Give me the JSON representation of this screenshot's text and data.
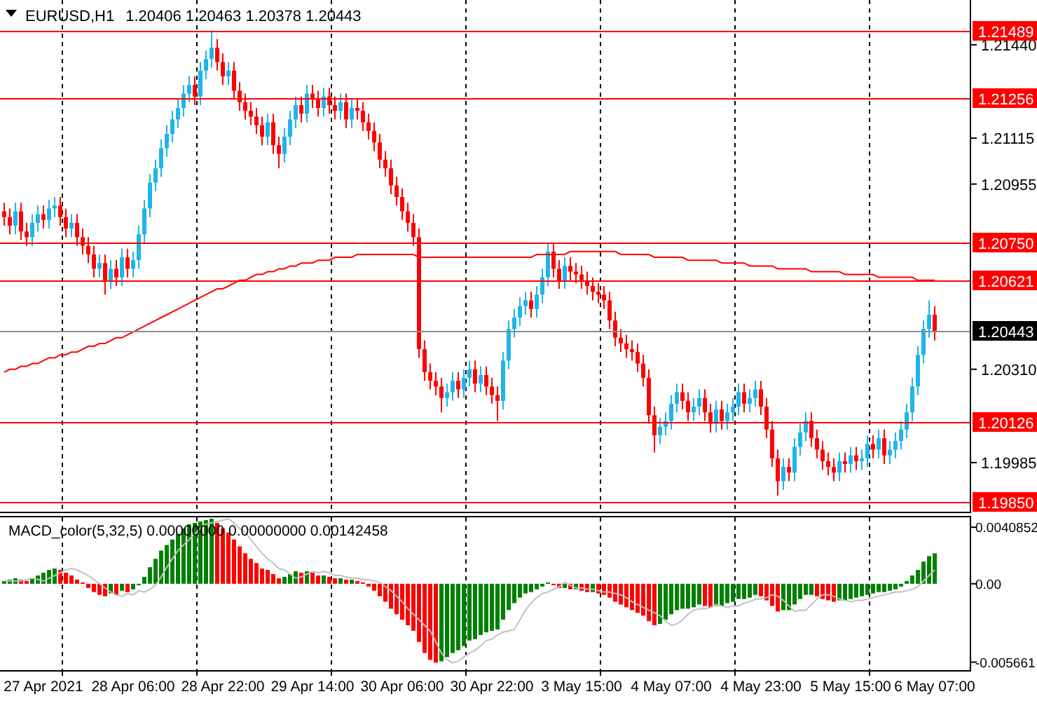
{
  "chart_header": {
    "symbol": "EURUSD,H1",
    "prices": [
      "1.20406",
      "1.20463",
      "1.20378",
      "1.20443"
    ]
  },
  "price_chart": {
    "chart_data": {
      "type": "candlestick",
      "ylim": [
        1.19809,
        1.21596
      ],
      "yticks": [
        {
          "value": 1.2144,
          "label": "1.21440"
        },
        {
          "value": 1.21115,
          "label": "1.21115"
        },
        {
          "value": 1.20955,
          "label": "1.20955"
        },
        {
          "value": 1.2031,
          "label": "1.20310"
        },
        {
          "value": 1.19985,
          "label": "1.19985"
        }
      ],
      "categories": [
        null,
        null,
        null,
        null,
        null,
        null,
        null,
        null,
        null,
        null,
        null,
        null,
        null,
        null,
        null,
        null,
        null,
        null,
        null,
        null,
        null,
        null,
        null,
        null,
        null,
        null,
        null,
        null,
        null,
        null,
        null,
        null,
        null,
        null,
        null,
        null,
        null,
        null,
        null,
        null,
        null,
        null,
        null,
        null,
        null,
        null,
        null,
        null,
        null,
        null,
        null,
        null,
        null,
        null,
        null,
        null,
        null,
        null,
        null,
        null,
        null,
        null,
        null,
        null,
        null,
        null,
        null,
        null,
        null,
        null,
        null,
        null,
        null,
        null,
        null,
        null,
        null,
        null,
        null,
        null,
        null,
        null,
        null,
        null,
        null,
        null,
        null,
        null,
        null,
        null,
        null,
        null,
        null,
        null,
        null,
        null,
        null,
        null,
        null,
        null,
        null,
        null,
        null,
        null,
        null,
        null,
        null,
        null,
        null,
        null,
        null,
        null,
        null,
        null,
        null,
        null,
        null,
        null,
        null,
        null,
        null,
        null,
        null,
        null,
        null,
        null,
        null,
        null,
        null,
        null,
        null,
        null,
        null,
        null,
        null,
        null,
        null,
        null,
        null,
        null,
        null,
        null,
        null,
        null,
        null,
        null,
        null,
        null,
        null,
        null,
        null,
        null,
        null,
        null,
        null,
        null,
        null,
        null,
        null,
        null,
        null,
        null,
        null,
        null,
        null,
        null,
        null
      ],
      "ohlc": [
        [
          1.2086,
          1.2089,
          1.2081,
          1.2084
        ],
        [
          1.2084,
          1.2087,
          1.2078,
          1.2081
        ],
        [
          1.2081,
          1.2089,
          1.2078,
          1.2086
        ],
        [
          1.2086,
          1.2089,
          1.2076,
          1.2079
        ],
        [
          1.2079,
          1.2082,
          1.2074,
          1.2077
        ],
        [
          1.2077,
          1.2085,
          1.2074,
          1.2082
        ],
        [
          1.2082,
          1.2088,
          1.2079,
          1.2085
        ],
        [
          1.2085,
          1.2088,
          1.208,
          1.2083
        ],
        [
          1.2083,
          1.209,
          1.208,
          1.2087
        ],
        [
          1.2087,
          1.2091,
          1.2084,
          1.2088
        ],
        [
          1.2088,
          1.2091,
          1.2081,
          1.2084
        ],
        [
          1.2084,
          1.2087,
          1.2077,
          1.208
        ],
        [
          1.208,
          1.2085,
          1.2077,
          1.2082
        ],
        [
          1.2082,
          1.2085,
          1.2074,
          1.2077
        ],
        [
          1.2077,
          1.208,
          1.2071,
          1.2074
        ],
        [
          1.2074,
          1.2077,
          1.2068,
          1.2071
        ],
        [
          1.2071,
          1.2074,
          1.2063,
          1.2066
        ],
        [
          1.2066,
          1.2071,
          1.2063,
          1.2068
        ],
        [
          1.2068,
          1.2071,
          1.2057,
          1.2062
        ],
        [
          1.2062,
          1.2069,
          1.2059,
          1.2066
        ],
        [
          1.2066,
          1.2069,
          1.206,
          1.2063
        ],
        [
          1.2063,
          1.2073,
          1.206,
          1.207
        ],
        [
          1.207,
          1.2073,
          1.2063,
          1.2066
        ],
        [
          1.2066,
          1.2072,
          1.2063,
          1.2069
        ],
        [
          1.2069,
          1.2081,
          1.2066,
          1.2078
        ],
        [
          1.2078,
          1.209,
          1.2075,
          1.2087
        ],
        [
          1.2087,
          1.2099,
          1.2084,
          1.2096
        ],
        [
          1.2096,
          1.2104,
          1.2093,
          1.2101
        ],
        [
          1.2101,
          1.2111,
          1.2098,
          1.2108
        ],
        [
          1.2108,
          1.2116,
          1.2105,
          1.2113
        ],
        [
          1.2113,
          1.2121,
          1.211,
          1.2118
        ],
        [
          1.2118,
          1.2125,
          1.2115,
          1.2122
        ],
        [
          1.2122,
          1.213,
          1.2119,
          1.2127
        ],
        [
          1.2127,
          1.2133,
          1.2124,
          1.213
        ],
        [
          1.213,
          1.2133,
          1.2123,
          1.2126
        ],
        [
          1.2126,
          1.2138,
          1.2123,
          1.2135
        ],
        [
          1.2135,
          1.2142,
          1.2132,
          1.2139
        ],
        [
          1.2139,
          1.2149,
          1.2136,
          1.2143
        ],
        [
          1.2143,
          1.2146,
          1.2135,
          1.2138
        ],
        [
          1.2138,
          1.2141,
          1.213,
          1.2133
        ],
        [
          1.2133,
          1.2138,
          1.213,
          1.2135
        ],
        [
          1.2135,
          1.2138,
          1.2125,
          1.2128
        ],
        [
          1.2128,
          1.2131,
          1.2121,
          1.2124
        ],
        [
          1.2124,
          1.2127,
          1.2118,
          1.2121
        ],
        [
          1.2121,
          1.2124,
          1.2116,
          1.2119
        ],
        [
          1.2119,
          1.2122,
          1.2113,
          1.2116
        ],
        [
          1.2116,
          1.2119,
          1.2109,
          1.2112
        ],
        [
          1.2112,
          1.212,
          1.2109,
          1.2117
        ],
        [
          1.2117,
          1.212,
          1.2106,
          1.2109
        ],
        [
          1.2109,
          1.2112,
          1.2101,
          1.2106
        ],
        [
          1.2106,
          1.2115,
          1.2103,
          1.2112
        ],
        [
          1.2112,
          1.2121,
          1.2109,
          1.2118
        ],
        [
          1.2118,
          1.2126,
          1.2115,
          1.2123
        ],
        [
          1.2123,
          1.2126,
          1.2117,
          1.212
        ],
        [
          1.212,
          1.213,
          1.2117,
          1.2127
        ],
        [
          1.2127,
          1.213,
          1.2122,
          1.2125
        ],
        [
          1.2125,
          1.2128,
          1.2119,
          1.2122
        ],
        [
          1.2122,
          1.2129,
          1.2119,
          1.2126
        ],
        [
          1.2126,
          1.2129,
          1.212,
          1.2123
        ],
        [
          1.2123,
          1.2126,
          1.2118,
          1.2121
        ],
        [
          1.2121,
          1.2127,
          1.2118,
          1.2124
        ],
        [
          1.2124,
          1.2127,
          1.2115,
          1.2118
        ],
        [
          1.2118,
          1.2125,
          1.2115,
          1.2122
        ],
        [
          1.2122,
          1.2125,
          1.2118,
          1.2121
        ],
        [
          1.2121,
          1.2124,
          1.2114,
          1.2117
        ],
        [
          1.2117,
          1.212,
          1.2111,
          1.2114
        ],
        [
          1.2114,
          1.2117,
          1.2107,
          1.211
        ],
        [
          1.211,
          1.2113,
          1.2101,
          1.2104
        ],
        [
          1.2104,
          1.2107,
          1.2098,
          1.2101
        ],
        [
          1.2101,
          1.2104,
          1.2092,
          1.2095
        ],
        [
          1.2095,
          1.2098,
          1.2088,
          1.2091
        ],
        [
          1.2091,
          1.2094,
          1.2083,
          1.2086
        ],
        [
          1.2086,
          1.2089,
          1.2079,
          1.2082
        ],
        [
          1.2082,
          1.2085,
          1.2074,
          1.2077
        ],
        [
          1.2077,
          1.208,
          1.2035,
          1.2038
        ],
        [
          1.2038,
          1.2041,
          1.2027,
          1.203
        ],
        [
          1.203,
          1.2033,
          1.2024,
          1.2027
        ],
        [
          1.2027,
          1.203,
          1.2022,
          1.2025
        ],
        [
          1.2025,
          1.2028,
          1.2016,
          1.2021
        ],
        [
          1.2021,
          1.2026,
          1.2018,
          1.2023
        ],
        [
          1.2023,
          1.203,
          1.202,
          1.2027
        ],
        [
          1.2027,
          1.203,
          1.2021,
          1.2024
        ],
        [
          1.2024,
          1.2031,
          1.2021,
          1.2028
        ],
        [
          1.2028,
          1.2034,
          1.2025,
          1.2031
        ],
        [
          1.2031,
          1.2034,
          1.2023,
          1.2026
        ],
        [
          1.2026,
          1.2032,
          1.2023,
          1.2029
        ],
        [
          1.2029,
          1.2032,
          1.2022,
          1.2025
        ],
        [
          1.2025,
          1.2028,
          1.2019,
          1.2022
        ],
        [
          1.2022,
          1.2025,
          1.2013,
          1.202
        ],
        [
          1.202,
          1.2037,
          1.2017,
          1.2034
        ],
        [
          1.2034,
          1.2048,
          1.2031,
          1.2045
        ],
        [
          1.2045,
          1.2052,
          1.2042,
          1.2049
        ],
        [
          1.2049,
          1.2056,
          1.2046,
          1.2053
        ],
        [
          1.2053,
          1.2058,
          1.205,
          1.2055
        ],
        [
          1.2055,
          1.2058,
          1.2049,
          1.2052
        ],
        [
          1.2052,
          1.206,
          1.2049,
          1.2057
        ],
        [
          1.2057,
          1.2066,
          1.2054,
          1.2063
        ],
        [
          1.2063,
          1.2075,
          1.206,
          1.2072
        ],
        [
          1.2072,
          1.2075,
          1.2063,
          1.2066
        ],
        [
          1.2066,
          1.2069,
          1.2059,
          1.2062
        ],
        [
          1.2062,
          1.207,
          1.2059,
          1.2067
        ],
        [
          1.2067,
          1.207,
          1.2062,
          1.2065
        ],
        [
          1.2065,
          1.2068,
          1.2061,
          1.2064
        ],
        [
          1.2064,
          1.2067,
          1.2059,
          1.2062
        ],
        [
          1.2062,
          1.2065,
          1.2057,
          1.206
        ],
        [
          1.206,
          1.2063,
          1.2055,
          1.2058
        ],
        [
          1.2058,
          1.2061,
          1.2054,
          1.2057
        ],
        [
          1.2057,
          1.206,
          1.2052,
          1.2055
        ],
        [
          1.2055,
          1.2058,
          1.2045,
          1.2048
        ],
        [
          1.2048,
          1.2051,
          1.2039,
          1.2042
        ],
        [
          1.2042,
          1.2045,
          1.2037,
          1.204
        ],
        [
          1.204,
          1.2043,
          1.2035,
          1.2038
        ],
        [
          1.2038,
          1.2041,
          1.2034,
          1.2037
        ],
        [
          1.2037,
          1.204,
          1.203,
          1.2033
        ],
        [
          1.2033,
          1.2036,
          1.2025,
          1.2028
        ],
        [
          1.2028,
          1.2031,
          1.2012,
          1.2015
        ],
        [
          1.2015,
          1.2018,
          1.2002,
          1.2008
        ],
        [
          1.2008,
          1.2014,
          1.2005,
          1.2011
        ],
        [
          1.2011,
          1.2016,
          1.2008,
          1.2013
        ],
        [
          1.2013,
          1.2022,
          1.201,
          1.2019
        ],
        [
          1.2019,
          1.2026,
          1.2016,
          1.2023
        ],
        [
          1.2023,
          1.2026,
          1.2017,
          1.202
        ],
        [
          1.202,
          1.2023,
          1.2013,
          1.2016
        ],
        [
          1.2016,
          1.2021,
          1.2013,
          1.2018
        ],
        [
          1.2018,
          1.2024,
          1.2015,
          1.2021
        ],
        [
          1.2021,
          1.2024,
          1.2013,
          1.2016
        ],
        [
          1.2016,
          1.2019,
          1.2009,
          1.2012
        ],
        [
          1.2012,
          1.202,
          1.2009,
          1.2017
        ],
        [
          1.2017,
          1.202,
          1.201,
          1.2013
        ],
        [
          1.2013,
          1.2019,
          1.201,
          1.2016
        ],
        [
          1.2016,
          1.2021,
          1.2013,
          1.2018
        ],
        [
          1.2018,
          1.2026,
          1.2015,
          1.2023
        ],
        [
          1.2023,
          1.2026,
          1.2016,
          1.2019
        ],
        [
          1.2019,
          1.2024,
          1.2016,
          1.2021
        ],
        [
          1.2021,
          1.2027,
          1.2018,
          1.2024
        ],
        [
          1.2024,
          1.2027,
          1.2015,
          1.2018
        ],
        [
          1.2018,
          1.2021,
          1.2007,
          1.201
        ],
        [
          1.201,
          1.2013,
          1.1997,
          1.2
        ],
        [
          1.2,
          1.2003,
          1.1987,
          1.1992
        ],
        [
          1.1992,
          1.2,
          1.1989,
          1.1997
        ],
        [
          1.1997,
          1.2,
          1.1992,
          1.1995
        ],
        [
          1.1995,
          1.2007,
          1.1992,
          1.2004
        ],
        [
          1.2004,
          1.2012,
          1.2001,
          1.2009
        ],
        [
          1.2009,
          1.2016,
          1.2006,
          1.2013
        ],
        [
          1.2013,
          1.2016,
          1.2004,
          1.2007
        ],
        [
          1.2007,
          1.201,
          1.2,
          1.2003
        ],
        [
          1.2003,
          1.2006,
          1.1996,
          1.1999
        ],
        [
          1.1999,
          1.2002,
          1.1994,
          1.1997
        ],
        [
          1.1997,
          1.2,
          1.1992,
          1.1995
        ],
        [
          1.1995,
          1.2002,
          1.1992,
          1.1999
        ],
        [
          1.1999,
          1.2002,
          1.1995,
          1.1998
        ],
        [
          1.1998,
          1.2004,
          1.1995,
          1.2001
        ],
        [
          1.2001,
          1.2004,
          1.1996,
          1.1999
        ],
        [
          1.1999,
          1.2003,
          1.1996,
          1.2
        ],
        [
          1.2,
          1.2008,
          1.1997,
          1.2005
        ],
        [
          1.2005,
          1.2008,
          1.2,
          1.2003
        ],
        [
          1.2003,
          1.201,
          1.2,
          1.2007
        ],
        [
          1.2007,
          1.201,
          1.1998,
          1.2001
        ],
        [
          1.2001,
          1.2006,
          1.1998,
          1.2003
        ],
        [
          1.2003,
          1.2009,
          1.2,
          1.2006
        ],
        [
          1.2006,
          1.2013,
          1.2003,
          1.201
        ],
        [
          1.201,
          1.2019,
          1.2007,
          1.2016
        ],
        [
          1.2016,
          1.2028,
          1.2013,
          1.2025
        ],
        [
          1.2025,
          1.2039,
          1.2022,
          1.2036
        ],
        [
          1.2036,
          1.2048,
          1.2033,
          1.2045
        ],
        [
          1.2045,
          1.2055,
          1.2042,
          1.205
        ],
        [
          1.205,
          1.2053,
          1.2041,
          1.2044
        ]
      ],
      "series": [
        {
          "type": "line",
          "color": "#ff0000",
          "values": [
            1.203,
            1.2031,
            1.2031,
            1.2032,
            1.2032,
            1.2033,
            1.2033,
            1.2034,
            1.2035,
            1.2035,
            1.2036,
            1.2036,
            1.2037,
            1.2037,
            1.2038,
            1.2039,
            1.2039,
            1.204,
            1.204,
            1.2041,
            1.2042,
            1.2042,
            1.2043,
            1.2044,
            1.2045,
            1.2046,
            1.2047,
            1.2048,
            1.2049,
            1.205,
            1.2051,
            1.2052,
            1.2053,
            1.2054,
            1.2055,
            1.2056,
            1.2057,
            1.2058,
            1.2059,
            1.2059,
            1.206,
            1.2061,
            1.2062,
            1.2062,
            1.2063,
            1.2064,
            1.2064,
            1.2065,
            1.2065,
            1.2066,
            1.2066,
            1.2067,
            1.2067,
            1.2068,
            1.2068,
            1.2068,
            1.2069,
            1.2069,
            1.2069,
            1.207,
            1.207,
            1.207,
            1.207,
            1.2071,
            1.2071,
            1.2071,
            1.2071,
            1.2071,
            1.2071,
            1.2071,
            1.2071,
            1.2071,
            1.2071,
            1.2071,
            1.207,
            1.207,
            1.207,
            1.207,
            1.207,
            1.207,
            1.207,
            1.207,
            1.207,
            1.207,
            1.207,
            1.207,
            1.207,
            1.207,
            1.207,
            1.207,
            1.207,
            1.207,
            1.207,
            1.207,
            1.207,
            1.2071,
            1.2071,
            1.2071,
            1.2071,
            1.2071,
            1.2071,
            1.2072,
            1.2072,
            1.2072,
            1.2072,
            1.2072,
            1.2072,
            1.2072,
            1.2072,
            1.2072,
            1.2071,
            1.2071,
            1.2071,
            1.2071,
            1.2071,
            1.2071,
            1.207,
            1.207,
            1.207,
            1.207,
            1.207,
            1.207,
            1.2069,
            1.2069,
            1.2069,
            1.2069,
            1.2069,
            1.2069,
            1.2068,
            1.2068,
            1.2068,
            1.2068,
            1.2068,
            1.2067,
            1.2067,
            1.2067,
            1.2067,
            1.2067,
            1.2066,
            1.2066,
            1.2066,
            1.2066,
            1.2066,
            1.2066,
            1.2065,
            1.2065,
            1.2065,
            1.2065,
            1.2065,
            1.2065,
            1.2064,
            1.2064,
            1.2064,
            1.2064,
            1.2064,
            1.2064,
            1.2063,
            1.2063,
            1.2063,
            1.2063,
            1.2063,
            1.2063,
            1.2063,
            1.2062,
            1.2062,
            1.2062,
            1.2062
          ]
        }
      ],
      "ref_lines": [
        {
          "axis": "y",
          "value": 1.21489,
          "label": "1.21489",
          "color": "#ff0000"
        },
        {
          "axis": "y",
          "value": 1.21256,
          "label": "1.21256",
          "color": "#ff0000"
        },
        {
          "axis": "y",
          "value": 1.2075,
          "label": "1.20750",
          "color": "#ff0000"
        },
        {
          "axis": "y",
          "value": 1.20621,
          "label": "1.20621",
          "color": "#ff0000"
        },
        {
          "axis": "y",
          "value": 1.20443,
          "label": "1.20443",
          "color": "#8c8c8c"
        },
        {
          "axis": "y",
          "value": 1.20126,
          "label": "1.20126",
          "color": "#ff0000"
        },
        {
          "axis": "y",
          "value": 1.1985,
          "label": "1.19850",
          "color": "#ff0000"
        }
      ]
    }
  },
  "indicator": {
    "label": "MACD_color(5,32,5) 0.00000000 0.00000000 0.00142458",
    "chart_data": {
      "type": "bar",
      "ylim": [
        -0.00624,
        0.0048
      ],
      "yticks": [
        {
          "value": 0.0040852,
          "label": "0.0040852"
        },
        {
          "value": 0,
          "label": "0.00"
        },
        {
          "value": -0.005661,
          "label": "-0.005661"
        }
      ],
      "categories": [
        null,
        null,
        null,
        null,
        null,
        null,
        null,
        "27 Apr 2021",
        null,
        null,
        null,
        null,
        null,
        null,
        null,
        null,
        null,
        null,
        null,
        null,
        null,
        null,
        null,
        "28 Apr 06:00",
        null,
        null,
        null,
        null,
        null,
        null,
        null,
        null,
        null,
        null,
        null,
        null,
        null,
        null,
        null,
        "28 Apr 22:00",
        null,
        null,
        null,
        null,
        null,
        null,
        null,
        null,
        null,
        null,
        null,
        null,
        null,
        null,
        null,
        "29 Apr 14:00",
        null,
        null,
        null,
        null,
        null,
        null,
        null,
        null,
        null,
        null,
        null,
        null,
        null,
        null,
        null,
        "30 Apr 06:00",
        null,
        null,
        null,
        null,
        null,
        null,
        null,
        null,
        null,
        null,
        null,
        null,
        null,
        null,
        null,
        "30 Apr 22:00",
        null,
        null,
        null,
        null,
        null,
        null,
        null,
        null,
        null,
        null,
        null,
        null,
        null,
        null,
        null,
        "3 May 15:00",
        null,
        null,
        null,
        null,
        null,
        null,
        null,
        null,
        null,
        null,
        null,
        null,
        null,
        null,
        null,
        "4 May 07:00",
        null,
        null,
        null,
        null,
        null,
        null,
        null,
        null,
        null,
        null,
        null,
        null,
        null,
        null,
        null,
        "4 May 23:00",
        null,
        null,
        null,
        null,
        null,
        null,
        null,
        null,
        null,
        null,
        null,
        null,
        null,
        null,
        null,
        "5 May 15:00",
        null,
        null,
        null,
        null,
        null,
        null,
        null,
        null,
        null,
        null,
        null,
        null,
        null,
        null,
        "6 May 07:00"
      ],
      "series": [
        {
          "type": "bar",
          "colors": [
            "#008000",
            "#008000",
            "#008000",
            "#ff0000",
            "#ff0000",
            "#008000",
            "#008000",
            "#008000",
            "#008000",
            "#008000",
            "#ff0000",
            "#ff0000",
            "#ff0000",
            "#ff0000",
            "#ff0000",
            "#ff0000",
            "#ff0000",
            "#ff0000",
            "#ff0000",
            "#008000",
            "#ff0000",
            "#008000",
            "#ff0000",
            "#008000",
            "#008000",
            "#008000",
            "#008000",
            "#008000",
            "#008000",
            "#008000",
            "#008000",
            "#008000",
            "#008000",
            "#008000",
            "#008000",
            "#008000",
            "#008000",
            "#008000",
            "#ff0000",
            "#ff0000",
            "#ff0000",
            "#ff0000",
            "#ff0000",
            "#ff0000",
            "#ff0000",
            "#ff0000",
            "#ff0000",
            "#ff0000",
            "#ff0000",
            "#ff0000",
            "#008000",
            "#008000",
            "#008000",
            "#ff0000",
            "#008000",
            "#ff0000",
            "#ff0000",
            "#008000",
            "#ff0000",
            "#ff0000",
            "#008000",
            "#ff0000",
            "#008000",
            "#ff0000",
            "#ff0000",
            "#ff0000",
            "#ff0000",
            "#ff0000",
            "#ff0000",
            "#ff0000",
            "#ff0000",
            "#ff0000",
            "#ff0000",
            "#ff0000",
            "#ff0000",
            "#ff0000",
            "#ff0000",
            "#ff0000",
            "#008000",
            "#008000",
            "#008000",
            "#008000",
            "#008000",
            "#008000",
            "#008000",
            "#008000",
            "#008000",
            "#008000",
            "#008000",
            "#008000",
            "#008000",
            "#008000",
            "#008000",
            "#008000",
            "#008000",
            "#008000",
            "#008000",
            "#008000",
            "#ff0000",
            "#ff0000",
            "#008000",
            "#ff0000",
            "#008000",
            "#ff0000",
            "#ff0000",
            "#008000",
            "#ff0000",
            "#ff0000",
            "#ff0000",
            "#ff0000",
            "#ff0000",
            "#ff0000",
            "#ff0000",
            "#ff0000",
            "#ff0000",
            "#ff0000",
            "#ff0000",
            "#008000",
            "#008000",
            "#008000",
            "#008000",
            "#008000",
            "#008000",
            "#008000",
            "#008000",
            "#ff0000",
            "#ff0000",
            "#008000",
            "#008000",
            "#008000",
            "#008000",
            "#008000",
            "#008000",
            "#008000",
            "#008000",
            "#ff0000",
            "#ff0000",
            "#ff0000",
            "#ff0000",
            "#008000",
            "#008000",
            "#008000",
            "#008000",
            "#008000",
            "#008000",
            "#ff0000",
            "#ff0000",
            "#ff0000",
            "#ff0000",
            "#008000",
            "#008000",
            "#008000",
            "#008000",
            "#008000",
            "#008000",
            "#008000",
            "#008000",
            "#008000",
            "#008000",
            "#008000",
            "#008000",
            "#008000",
            "#008000",
            "#008000",
            "#008000",
            "#008000",
            "#008000"
          ],
          "values": [
            0.0002,
            0.0003,
            0.0004,
            0.0003,
            0.0002,
            0.0004,
            0.0006,
            0.0008,
            0.001,
            0.0011,
            0.001,
            0.0008,
            0.0006,
            0.0003,
            0.0001,
            -0.0003,
            -0.0006,
            -0.0008,
            -0.0009,
            -0.0007,
            -0.0008,
            -0.0005,
            -0.0006,
            -0.0004,
            -0.0001,
            0.0005,
            0.0012,
            0.0018,
            0.0024,
            0.0028,
            0.0032,
            0.0036,
            0.004,
            0.0043,
            0.0044,
            0.0045,
            0.0046,
            0.0047,
            0.0044,
            0.004,
            0.0037,
            0.0032,
            0.0027,
            0.0022,
            0.0018,
            0.0015,
            0.0011,
            0.001,
            0.0007,
            0.0004,
            0.0005,
            0.0007,
            0.0009,
            0.0008,
            0.0009,
            0.0008,
            0.0006,
            0.0006,
            0.0005,
            0.0004,
            0.0004,
            0.0003,
            0.0003,
            0.0002,
            0.0001,
            -0.0002,
            -0.0005,
            -0.0009,
            -0.0013,
            -0.0018,
            -0.0022,
            -0.0026,
            -0.003,
            -0.0034,
            -0.0042,
            -0.005,
            -0.0055,
            -0.0057,
            -0.0056,
            -0.0053,
            -0.005,
            -0.0048,
            -0.0045,
            -0.0041,
            -0.004,
            -0.0037,
            -0.0035,
            -0.0034,
            -0.0033,
            -0.0026,
            -0.0019,
            -0.0014,
            -0.001,
            -0.0007,
            -0.0006,
            -0.0004,
            -0.0002,
            0.0001,
            -0.0001,
            -0.0003,
            -0.0003,
            -0.0004,
            -0.0004,
            -0.0005,
            -0.0006,
            -0.0006,
            -0.0007,
            -0.0008,
            -0.001,
            -0.0013,
            -0.0015,
            -0.0017,
            -0.0019,
            -0.0021,
            -0.0023,
            -0.0027,
            -0.003,
            -0.0029,
            -0.0026,
            -0.0022,
            -0.0019,
            -0.0018,
            -0.0018,
            -0.0017,
            -0.0015,
            -0.0016,
            -0.0017,
            -0.0016,
            -0.0016,
            -0.0014,
            -0.0013,
            -0.0011,
            -0.0011,
            -0.001,
            -0.0008,
            -0.0009,
            -0.0012,
            -0.0016,
            -0.002,
            -0.0019,
            -0.0019,
            -0.0015,
            -0.0011,
            -0.0008,
            -0.0008,
            -0.0009,
            -0.0011,
            -0.0012,
            -0.0013,
            -0.0012,
            -0.0012,
            -0.0011,
            -0.001,
            -0.0009,
            -0.0008,
            -0.0007,
            -0.0006,
            -0.0006,
            -0.0005,
            -0.0004,
            -0.0002,
            0.0002,
            0.0006,
            0.001,
            0.0016,
            0.002,
            0.0022
          ]
        },
        {
          "type": "line",
          "color": "#c0c0c0",
          "values": [
            0.0002,
            0.0002,
            0.0002,
            0.0002,
            0.0003,
            0.0004,
            0.0003,
            0.0002,
            0.0004,
            0.0006,
            0.0008,
            0.001,
            0.0011,
            0.001,
            0.0008,
            0.0006,
            0.0003,
            0,
            -0.0003,
            -0.0006,
            -0.0008,
            -0.0009,
            -0.0007,
            -0.0008,
            -0.0005,
            -0.0006,
            -0.0004,
            -0.0001,
            0.0005,
            0.0012,
            0.0018,
            0.0024,
            0.0028,
            0.0032,
            0.0036,
            0.004,
            0.0043,
            0.0044,
            0.0045,
            0.0046,
            0.0047,
            0.0044,
            0.004,
            0.0037,
            0.0032,
            0.0027,
            0.0022,
            0.0018,
            0.0015,
            0.0011,
            0.001,
            0.0007,
            0.0004,
            0.0005,
            0.0007,
            0.0009,
            0.0008,
            0.0009,
            0.0008,
            0.0006,
            0.0006,
            0.0005,
            0.0004,
            0.0004,
            0.0003,
            0.0003,
            0.0002,
            0.0001,
            -0.0002,
            -0.0005,
            -0.0009,
            -0.0013,
            -0.0018,
            -0.0022,
            -0.0026,
            -0.003,
            -0.0034,
            -0.0042,
            -0.005,
            -0.0055,
            -0.0057,
            -0.0056,
            -0.0053,
            -0.005,
            -0.0048,
            -0.0045,
            -0.0041,
            -0.004,
            -0.0037,
            -0.0035,
            -0.0034,
            -0.0033,
            -0.0026,
            -0.0019,
            -0.0014,
            -0.001,
            -0.0007,
            -0.0006,
            -0.0004,
            -0.0002,
            0.0001,
            -0.0001,
            -0.0003,
            -0.0003,
            -0.0004,
            -0.0004,
            -0.0005,
            -0.0006,
            -0.0006,
            -0.0007,
            -0.0008,
            -0.001,
            -0.0013,
            -0.0015,
            -0.0017,
            -0.0019,
            -0.0021,
            -0.0023,
            -0.0027,
            -0.003,
            -0.0029,
            -0.0026,
            -0.0022,
            -0.0019,
            -0.0018,
            -0.0018,
            -0.0017,
            -0.0015,
            -0.0016,
            -0.0017,
            -0.0016,
            -0.0016,
            -0.0014,
            -0.0013,
            -0.0011,
            -0.0011,
            -0.001,
            -0.0008,
            -0.0009,
            -0.0012,
            -0.0016,
            -0.002,
            -0.0019,
            -0.0019,
            -0.0015,
            -0.0011,
            -0.0008,
            -0.0008,
            -0.0009,
            -0.0011,
            -0.0012,
            -0.0013,
            -0.0012,
            -0.0012,
            -0.0011,
            -0.001,
            -0.0009,
            -0.0008,
            -0.0007,
            -0.0006,
            -0.0006,
            -0.0005,
            -0.0004,
            -0.0002,
            0.0002,
            0.0006,
            0.001
          ]
        }
      ]
    }
  }
}
